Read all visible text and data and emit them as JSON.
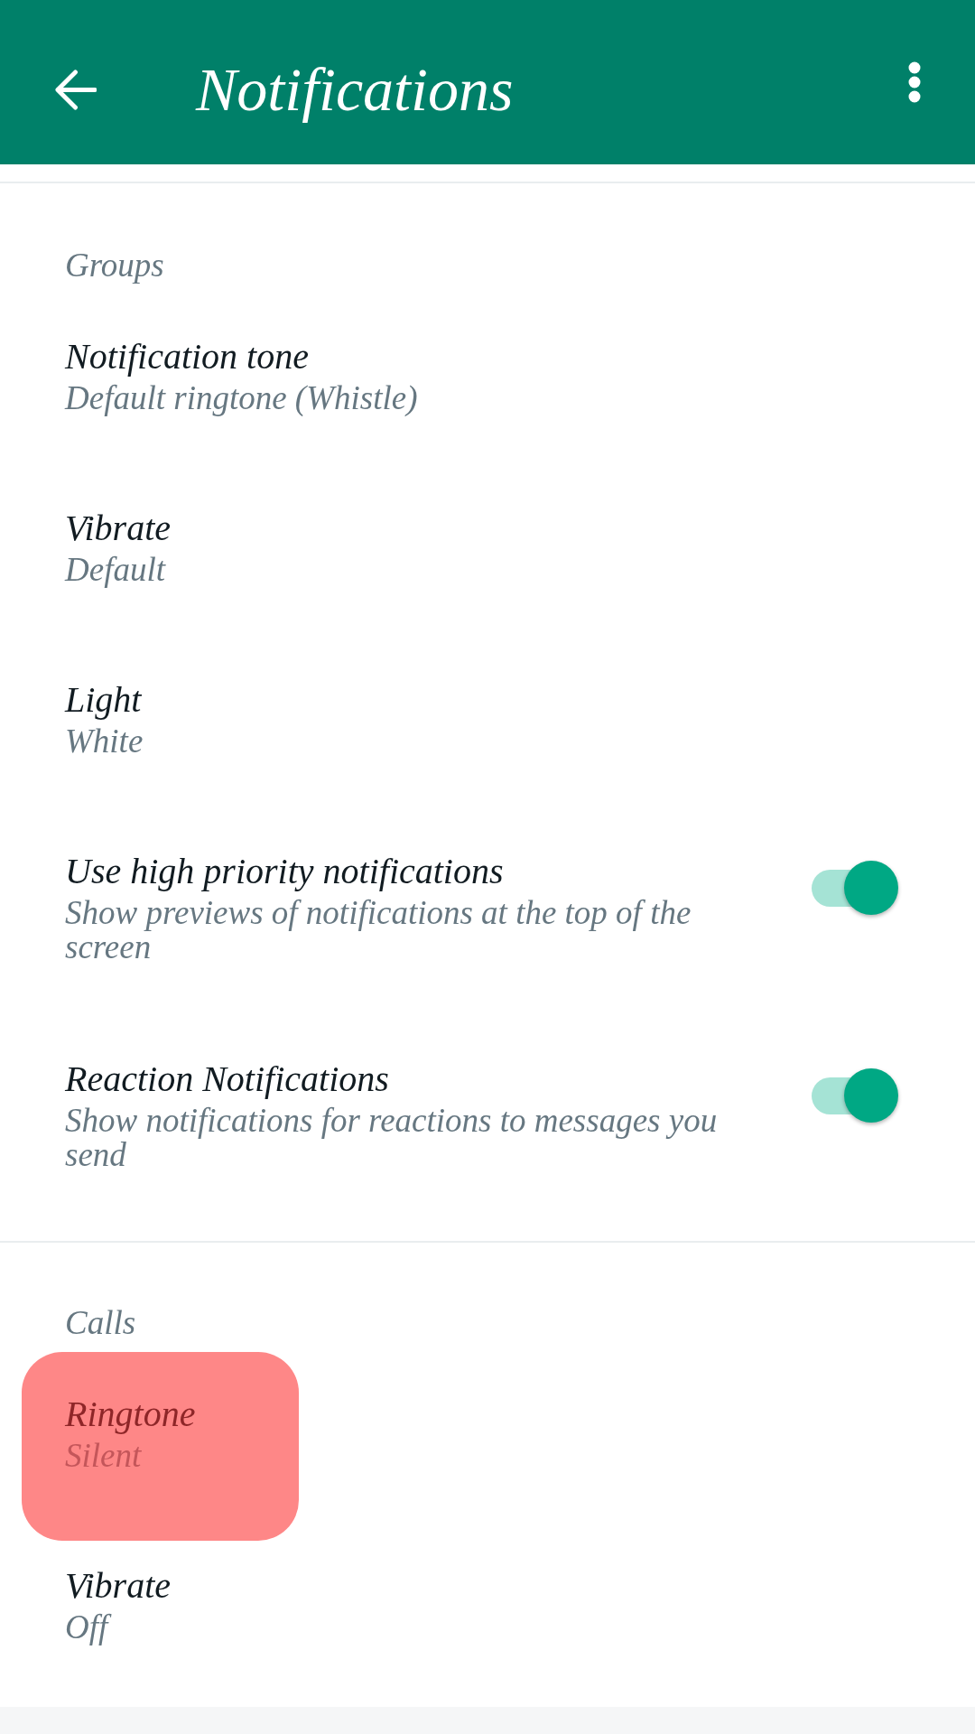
{
  "app_bar": {
    "title": "Notifications"
  },
  "sections": [
    {
      "header": "Groups",
      "items": [
        {
          "kind": "option",
          "title": "Notification tone",
          "subtitle": "Default ringtone (Whistle)",
          "highlighted": false
        },
        {
          "kind": "option",
          "title": "Vibrate",
          "subtitle": "Default",
          "highlighted": false
        },
        {
          "kind": "option",
          "title": "Light",
          "subtitle": "White",
          "highlighted": false
        },
        {
          "kind": "toggle",
          "title": "Use high priority notifications",
          "subtitle": "Show previews of notifications at the top of the screen",
          "on": true,
          "highlighted": false
        },
        {
          "kind": "toggle",
          "title": "Reaction Notifications",
          "subtitle": "Show notifications for reactions to messages you send",
          "on": true,
          "highlighted": false
        }
      ]
    },
    {
      "header": "Calls",
      "items": [
        {
          "kind": "option",
          "title": "Ringtone",
          "subtitle": "Silent",
          "highlighted": true
        },
        {
          "kind": "option",
          "title": "Vibrate",
          "subtitle": "Off",
          "highlighted": false
        }
      ]
    }
  ]
}
